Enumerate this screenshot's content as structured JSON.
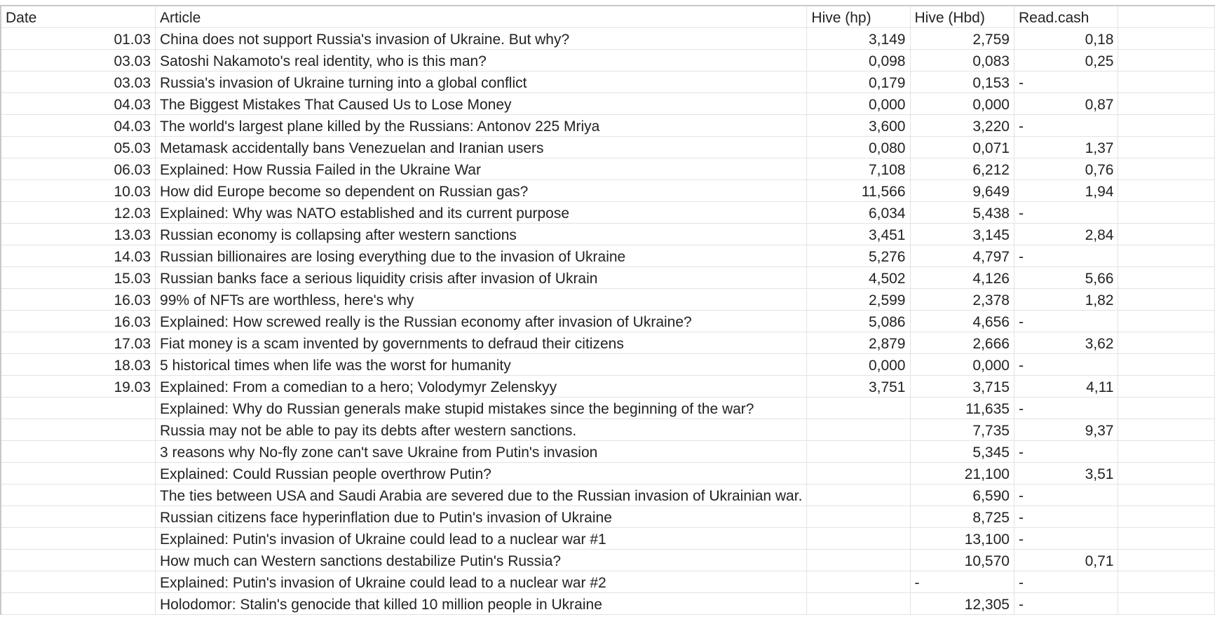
{
  "headers": [
    "Date",
    "Article",
    "Hive (hp)",
    "Hive (Hbd)",
    "Read.cash",
    ""
  ],
  "rows": [
    {
      "date": "01.03",
      "article": "China does not support Russia's invasion of Ukraine. But why?",
      "hp": "3,149",
      "hbd": "2,759",
      "readcash": "0,18"
    },
    {
      "date": "03.03",
      "article": "Satoshi Nakamoto's real identity, who is this man?",
      "hp": "0,098",
      "hbd": "0,083",
      "readcash": "0,25"
    },
    {
      "date": "03.03",
      "article": "Russia's invasion of Ukraine turning into a global conflict",
      "hp": "0,179",
      "hbd": "0,153",
      "readcash": "-"
    },
    {
      "date": "04.03",
      "article": "The Biggest Mistakes That Caused Us to Lose Money",
      "hp": "0,000",
      "hbd": "0,000",
      "readcash": "0,87"
    },
    {
      "date": "04.03",
      "article": "The world's largest plane killed by the Russians: Antonov 225 Mriya",
      "hp": "3,600",
      "hbd": "3,220",
      "readcash": "-"
    },
    {
      "date": "05.03",
      "article": "Metamask accidentally bans Venezuelan and Iranian users",
      "hp": "0,080",
      "hbd": "0,071",
      "readcash": "1,37"
    },
    {
      "date": "06.03",
      "article": "Explained: How Russia Failed in the Ukraine War",
      "hp": "7,108",
      "hbd": "6,212",
      "readcash": "0,76"
    },
    {
      "date": "10.03",
      "article": "How did Europe become so dependent on Russian gas?",
      "hp": "11,566",
      "hbd": "9,649",
      "readcash": "1,94"
    },
    {
      "date": "12.03",
      "article": "Explained: Why was NATO established and its current purpose",
      "hp": "6,034",
      "hbd": "5,438",
      "readcash": "-"
    },
    {
      "date": "13.03",
      "article": "Russian economy is collapsing after western sanctions",
      "hp": "3,451",
      "hbd": "3,145",
      "readcash": "2,84"
    },
    {
      "date": "14.03",
      "article": "Russian billionaires are losing everything due to the invasion of Ukraine",
      "hp": "5,276",
      "hbd": "4,797",
      "readcash": "-"
    },
    {
      "date": "15.03",
      "article": "Russian banks face a serious liquidity crisis after invasion of Ukrain",
      "hp": "4,502",
      "hbd": "4,126",
      "readcash": "5,66"
    },
    {
      "date": "16.03",
      "article": "99% of NFTs are worthless, here's why",
      "hp": "2,599",
      "hbd": "2,378",
      "readcash": "1,82"
    },
    {
      "date": "16.03",
      "article": "Explained: How screwed really is the Russian economy after invasion of Ukraine?",
      "hp": "5,086",
      "hbd": "4,656",
      "readcash": "-"
    },
    {
      "date": "17.03",
      "article": "Fiat money is a scam invented by governments to defraud their citizens",
      "hp": "2,879",
      "hbd": "2,666",
      "readcash": "3,62"
    },
    {
      "date": "18.03",
      "article": "5 historical times when life was the worst for humanity",
      "hp": "0,000",
      "hbd": "0,000",
      "readcash": "-"
    },
    {
      "date": "19.03",
      "article": "Explained: From a comedian to a hero; Volodymyr Zelenskyy",
      "hp": "3,751",
      "hbd": "3,715",
      "readcash": "4,11"
    },
    {
      "date": "",
      "article": "Explained: Why do Russian generals make stupid mistakes since the beginning of the war?",
      "hp": "",
      "hbd": "11,635",
      "readcash": "-"
    },
    {
      "date": "",
      "article": "Russia may not be able to pay its debts after western sanctions.",
      "hp": "",
      "hbd": "7,735",
      "readcash": "9,37"
    },
    {
      "date": "",
      "article": "3 reasons why No-fly zone can't save Ukraine from Putin's invasion",
      "hp": "",
      "hbd": "5,345",
      "readcash": "-"
    },
    {
      "date": "",
      "article": "Explained: Could Russian people overthrow Putin?",
      "hp": "",
      "hbd": "21,100",
      "readcash": "3,51"
    },
    {
      "date": "",
      "article": "The ties between USA and Saudi Arabia are severed due to the Russian invasion of Ukrainian war.",
      "hp": "",
      "hbd": "6,590",
      "readcash": "-"
    },
    {
      "date": "",
      "article": "Russian citizens face hyperinflation due to Putin's invasion of Ukraine",
      "hp": "",
      "hbd": "8,725",
      "readcash": "-"
    },
    {
      "date": "",
      "article": "Explained: Putin's invasion of Ukraine could lead to a nuclear war #1",
      "hp": "",
      "hbd": "13,100",
      "readcash": "-"
    },
    {
      "date": "",
      "article": "How much can Western sanctions destabilize Putin's Russia?",
      "hp": "",
      "hbd": "10,570",
      "readcash": "0,71"
    },
    {
      "date": "",
      "article": "Explained: Putin's invasion of Ukraine could lead to a nuclear war #2",
      "hp": "",
      "hbd": "-",
      "readcash": "-"
    },
    {
      "date": "",
      "article": "Holodomor: Stalin's genocide that killed 10 million people in Ukraine",
      "hp": "",
      "hbd": "12,305",
      "readcash": "-"
    }
  ]
}
